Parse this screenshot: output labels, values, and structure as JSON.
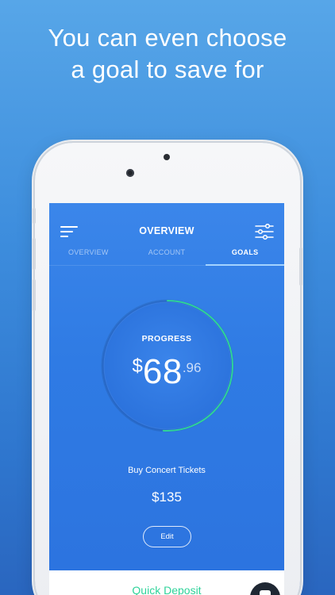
{
  "headline": {
    "line1": "You can even choose",
    "line2": "a goal to save for"
  },
  "app": {
    "title": "OVERVIEW",
    "tabs": [
      {
        "label": "OVERVIEW",
        "active": false
      },
      {
        "label": "ACCOUNT",
        "active": false
      },
      {
        "label": "GOALS",
        "active": true
      }
    ],
    "progress": {
      "label": "PROGRESS",
      "currency": "$",
      "whole": "68",
      "cents": ".96",
      "fraction": 0.51
    },
    "goal": {
      "name": "Buy Concert Tickets",
      "target": "$135"
    },
    "edit_label": "Edit",
    "quick_deposit_label": "Quick Deposit"
  },
  "colors": {
    "background_top": "#57a6e8",
    "background_bottom": "#2a66bf",
    "screen": "#2f7de4",
    "accent_green": "#2fd39a",
    "tab_indicator": "#9ed0ff",
    "chat_button": "#1f2733"
  },
  "icons": {
    "menu": "hamburger-icon",
    "filter": "sliders-icon",
    "chat": "chat-icon"
  }
}
